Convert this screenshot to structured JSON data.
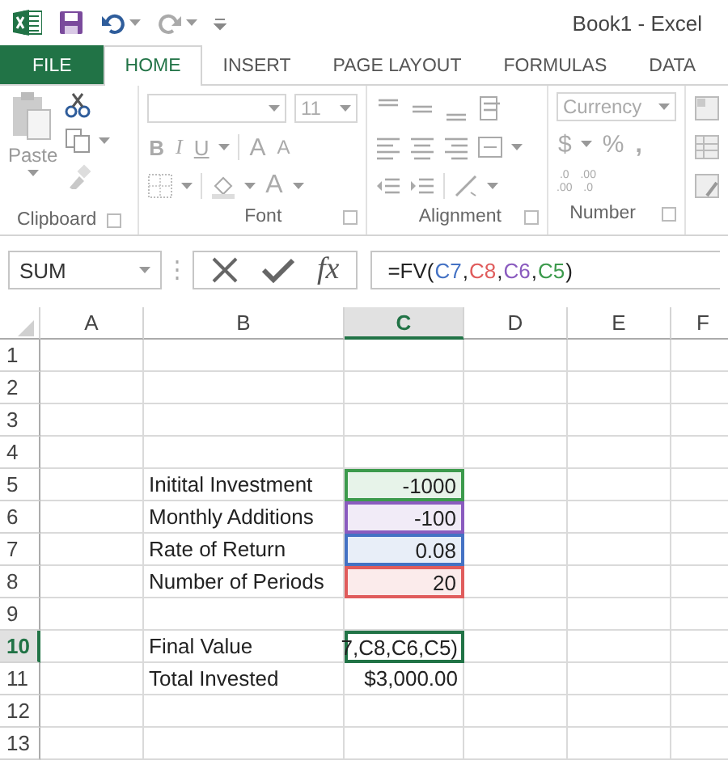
{
  "title_bar": {
    "title": "Book1 - Excel"
  },
  "tabs": [
    {
      "label": "FILE",
      "kind": "file",
      "selected": false
    },
    {
      "label": "HOME",
      "kind": "tab",
      "selected": true
    },
    {
      "label": "INSERT",
      "kind": "tab",
      "selected": false
    },
    {
      "label": "PAGE LAYOUT",
      "kind": "tab",
      "selected": false
    },
    {
      "label": "FORMULAS",
      "kind": "tab",
      "selected": false
    },
    {
      "label": "DATA",
      "kind": "tab",
      "selected": false
    }
  ],
  "ribbon": {
    "disabled": true,
    "clipboard": {
      "label": "Clipboard",
      "paste": "Paste"
    },
    "font": {
      "label": "Font",
      "size": "11",
      "bold": "B",
      "italic": "I",
      "underline": "U",
      "grow": "A",
      "shrink": "A",
      "font_color_button": "A"
    },
    "alignment": {
      "label": "Alignment"
    },
    "number": {
      "label": "Number",
      "format": "Currency",
      "currency": "$",
      "percent": "%",
      "comma": ",",
      "decimals": [
        {
          "top": ".0",
          "bottom": ".00"
        },
        {
          "top": ".00",
          "bottom": ".0"
        }
      ]
    }
  },
  "formula_bar": {
    "name_box": "SUM",
    "fx": "fx",
    "formula": [
      {
        "text": "=FV(",
        "color": "#222222"
      },
      {
        "text": "C7",
        "color": "#4472c4"
      },
      {
        "text": ",",
        "color": "#222222"
      },
      {
        "text": "C8",
        "color": "#e05c5c"
      },
      {
        "text": ",",
        "color": "#222222"
      },
      {
        "text": "C6",
        "color": "#8a5bbf"
      },
      {
        "text": ",",
        "color": "#222222"
      },
      {
        "text": "C5",
        "color": "#3c9a4c"
      },
      {
        "text": ")",
        "color": "#222222"
      }
    ]
  },
  "columns": [
    {
      "label": "A",
      "selected": false
    },
    {
      "label": "B",
      "selected": false
    },
    {
      "label": "C",
      "selected": true
    },
    {
      "label": "D",
      "selected": false
    },
    {
      "label": "E",
      "selected": false
    },
    {
      "label": "F",
      "selected": false
    }
  ],
  "rows": [
    {
      "number": "1",
      "selected": false
    },
    {
      "number": "2",
      "selected": false
    },
    {
      "number": "3",
      "selected": false
    },
    {
      "number": "4",
      "selected": false
    },
    {
      "number": "5",
      "selected": false,
      "label": "Initital Investment",
      "value": "-1000",
      "color": "#3c9a4c"
    },
    {
      "number": "6",
      "selected": false,
      "label": "Monthly Additions",
      "value": "-100",
      "color": "#8a5bbf"
    },
    {
      "number": "7",
      "selected": false,
      "label": "Rate of Return",
      "value": "0.08",
      "color": "#4472c4"
    },
    {
      "number": "8",
      "selected": false,
      "label": "Number of Periods",
      "value": "20",
      "color": "#e05c5c"
    },
    {
      "number": "9",
      "selected": false
    },
    {
      "number": "10",
      "selected": true,
      "label": "Final Value",
      "value": "7,C8,C6,C5)"
    },
    {
      "number": "11",
      "selected": false,
      "label": "Total Invested",
      "value": "$3,000.00"
    },
    {
      "number": "12",
      "selected": false
    },
    {
      "number": "13",
      "selected": false
    }
  ]
}
